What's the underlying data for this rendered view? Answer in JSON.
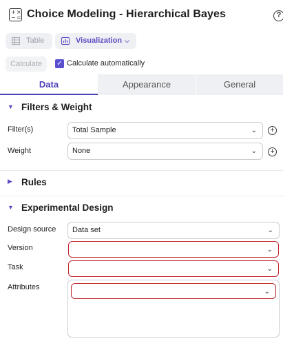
{
  "header": {
    "title": "Choice Modeling - Hierarchical Bayes",
    "app_icon": "calculator-icon",
    "help_icon": "help-icon"
  },
  "toolbar": {
    "table_label": "Table",
    "visualization_label": "Visualization",
    "accent_color": "#5b4bc4"
  },
  "calc": {
    "calculate_label": "Calculate",
    "auto_label": "Calculate automatically",
    "auto_checked": true
  },
  "tabs": [
    {
      "label": "Data",
      "active": true
    },
    {
      "label": "Appearance",
      "active": false
    },
    {
      "label": "General",
      "active": false
    }
  ],
  "filters_section": {
    "title": "Filters & Weight",
    "expanded": true,
    "filter_label": "Filter(s)",
    "filter_value": "Total Sample",
    "weight_label": "Weight",
    "weight_value": "None"
  },
  "rules_section": {
    "title": "Rules",
    "expanded": false
  },
  "design_section": {
    "title": "Experimental Design",
    "expanded": true,
    "source_label": "Design source",
    "source_value": "Data set",
    "version_label": "Version",
    "version_value": "",
    "task_label": "Task",
    "task_value": "",
    "attributes_label": "Attributes",
    "attributes_value": "",
    "error_color": "#c0272d"
  }
}
